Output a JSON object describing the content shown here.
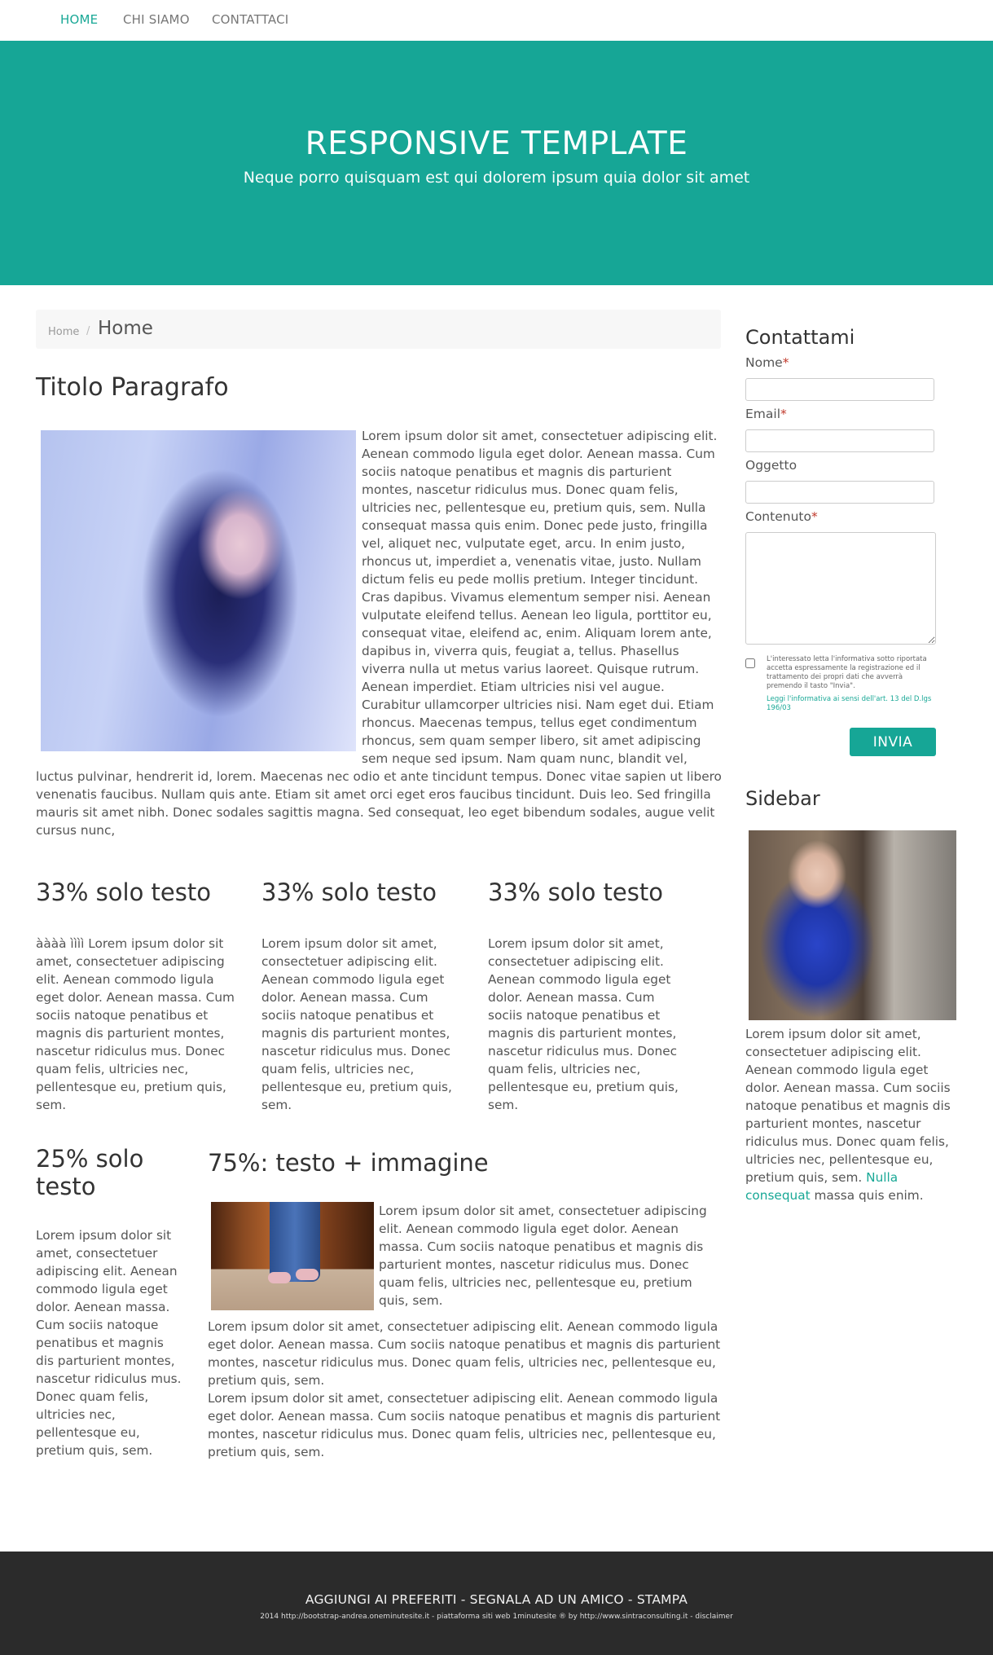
{
  "nav": {
    "items": [
      {
        "label": "HOME",
        "active": true
      },
      {
        "label": "CHI SIAMO",
        "active": false
      },
      {
        "label": "CONTATTACI",
        "active": false
      }
    ]
  },
  "hero": {
    "title": "RESPONSIVE TEMPLATE",
    "subtitle": "Neque porro quisquam est qui dolorem ipsum quia dolor sit amet"
  },
  "breadcrumb": {
    "home": "Home",
    "separator": "/",
    "current": "Home"
  },
  "main": {
    "heading": "Titolo Paragrafo",
    "intro_text": "Lorem ipsum dolor sit amet, consectetuer adipiscing elit. Aenean commodo ligula eget dolor. Aenean massa. Cum sociis natoque penatibus et magnis dis parturient montes, nascetur ridiculus mus. Donec quam felis, ultricies nec, pellentesque eu, pretium quis, sem. Nulla consequat massa quis enim. Donec pede justo, fringilla vel, aliquet nec, vulputate eget, arcu. In enim justo, rhoncus ut, imperdiet a, venenatis vitae, justo. Nullam dictum felis eu pede mollis pretium. Integer tincidunt. Cras dapibus. Vivamus elementum semper nisi. Aenean vulputate eleifend tellus. Aenean leo ligula, porttitor eu, consequat vitae, eleifend ac, enim. Aliquam lorem ante, dapibus in, viverra quis, feugiat a, tellus. Phasellus viverra nulla ut metus varius laoreet. Quisque rutrum. Aenean imperdiet. Etiam ultricies nisi vel augue. Curabitur ullamcorper ultricies nisi. Nam eget dui. Etiam rhoncus. Maecenas tempus, tellus eget condimentum rhoncus, sem quam semper libero, sit amet adipiscing sem neque sed ipsum. Nam quam nunc, blandit vel, luctus pulvinar, hendrerit id, lorem. Maecenas nec odio et ante tincidunt tempus. Donec vitae sapien ut libero venenatis faucibus. Nullam quis ante. Etiam sit amet orci eget eros faucibus tincidunt. Duis leo. Sed fringilla mauris sit amet nibh. Donec sodales sagittis magna. Sed consequat, leo eget bibendum sodales, augue velit cursus nunc,",
    "columns33": [
      {
        "title": "33% solo testo",
        "text": "àààà ìììì Lorem ipsum dolor sit amet, consectetuer adipiscing elit. Aenean commodo ligula eget dolor. Aenean massa. Cum sociis natoque penatibus et magnis dis parturient montes, nascetur ridiculus mus. Donec quam felis, ultricies nec, pellentesque eu, pretium quis, sem."
      },
      {
        "title": "33% solo testo",
        "text": "Lorem ipsum dolor sit amet, consectetuer adipiscing elit. Aenean commodo ligula eget dolor. Aenean massa. Cum sociis natoque penatibus et magnis dis parturient montes, nascetur ridiculus mus. Donec quam felis, ultricies nec, pellentesque eu, pretium quis, sem."
      },
      {
        "title": "33% solo testo",
        "text": "Lorem ipsum dolor sit amet, consectetuer adipiscing elit. Aenean commodo ligula eget dolor. Aenean massa. Cum sociis natoque penatibus et magnis dis parturient montes, nascetur ridiculus mus. Donec quam felis, ultricies nec, pellentesque eu, pretium quis, sem."
      }
    ],
    "col25": {
      "title": "25% solo testo",
      "text": "Lorem ipsum dolor sit amet, consectetuer adipiscing elit. Aenean commodo ligula eget dolor. Aenean massa. Cum sociis natoque penatibus et magnis dis parturient montes, nascetur ridiculus mus. Donec quam felis, ultricies nec, pellentesque eu, pretium quis, sem."
    },
    "col75": {
      "title": "75%: testo + immagine",
      "p1": "Lorem ipsum dolor sit amet, consectetuer adipiscing elit. Aenean commodo ligula eget dolor. Aenean massa. Cum sociis natoque penatibus et magnis dis parturient montes, nascetur ridiculus mus. Donec quam felis, ultricies nec, pellentesque eu, pretium quis, sem.",
      "p2": "Lorem ipsum dolor sit amet, consectetuer adipiscing elit. Aenean commodo ligula eget dolor. Aenean massa. Cum sociis natoque penatibus et magnis dis parturient montes, nascetur ridiculus mus. Donec quam felis, ultricies nec, pellentesque eu, pretium quis, sem.",
      "p3": "Lorem ipsum dolor sit amet, consectetuer adipiscing elit. Aenean commodo ligula eget dolor. Aenean massa. Cum sociis natoque penatibus et magnis dis parturient montes, nascetur ridiculus mus. Donec quam felis, ultricies nec, pellentesque eu, pretium quis, sem."
    }
  },
  "contact": {
    "title": "Contattami",
    "required_mark": "*",
    "name_label": "Nome",
    "email_label": "Email",
    "subject_label": "Oggetto",
    "content_label": "Contenuto",
    "privacy_text": "L'interessato letta l'informativa sotto riportata accetta espressamente la registrazione ed il trattamento dei propri dati che avverrà premendo il tasto \"Invia\".",
    "privacy_link": "Leggi l'informativa ai sensi dell'art. 13 del D.lgs 196/03",
    "submit_label": "INVIA"
  },
  "sidebar": {
    "title": "Sidebar",
    "text_before": "Lorem ipsum dolor sit amet, consectetuer adipiscing elit. Aenean commodo ligula eget dolor. Aenean massa. Cum sociis natoque penatibus et magnis dis parturient montes, nascetur ridiculus mus. Donec quam felis, ultricies nec, pellentesque eu, pretium quis, sem.",
    "link_text": "Nulla consequat",
    "text_after": "massa quis enim."
  },
  "footer": {
    "add_favorites": "AGGIUNGI AI PREFERITI",
    "tell_friend": "SEGNALA AD UN AMICO",
    "print": "STAMPA",
    "separator": " - ",
    "credit": "2014 http://bootstrap-andrea.oneminutesite.it - piattaforma siti web 1minutesite ® by http://www.sintraconsulting.it - disclaimer"
  },
  "colors": {
    "accent": "#16a696",
    "footer_bg": "#2b2b2b",
    "breadcrumb_bg": "#f7f7f7"
  }
}
